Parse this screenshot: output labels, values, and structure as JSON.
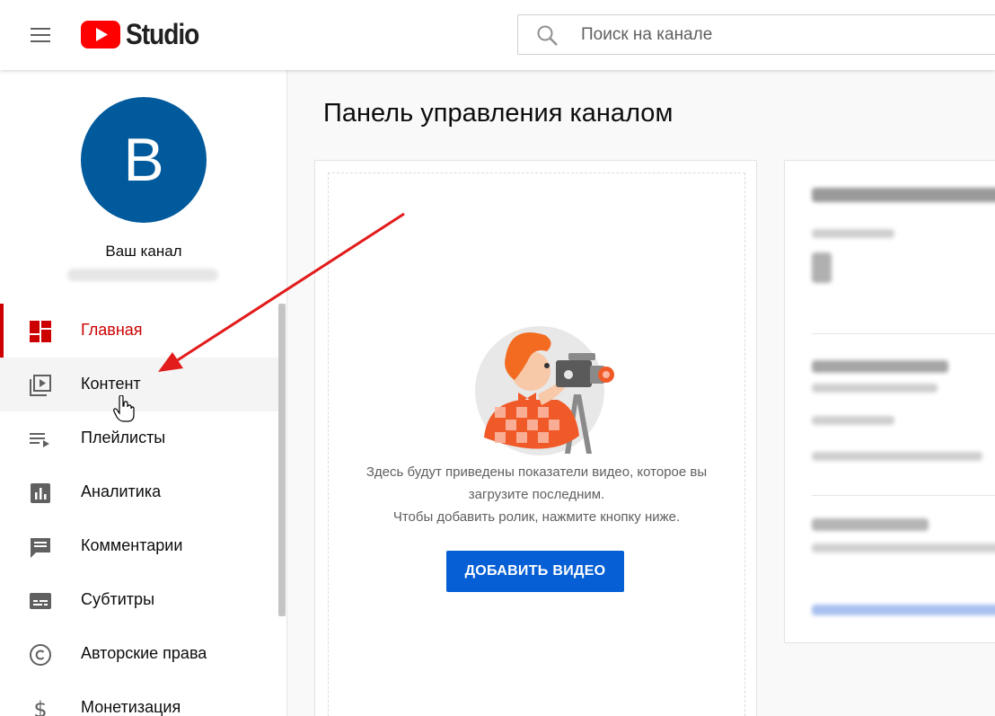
{
  "header": {
    "logo_text": "Studio",
    "search_placeholder": "Поиск на канале"
  },
  "sidebar": {
    "avatar_letter": "B",
    "channel_name": "Ваш канал",
    "items": [
      {
        "label": "Главная",
        "icon": "dashboard-icon",
        "active": true
      },
      {
        "label": "Контент",
        "icon": "content-icon"
      },
      {
        "label": "Плейлисты",
        "icon": "playlists-icon"
      },
      {
        "label": "Аналитика",
        "icon": "analytics-icon"
      },
      {
        "label": "Комментарии",
        "icon": "comments-icon"
      },
      {
        "label": "Субтитры",
        "icon": "subtitles-icon"
      },
      {
        "label": "Авторские права",
        "icon": "copyright-icon"
      },
      {
        "label": "Монетизация",
        "icon": "monetization-icon"
      }
    ]
  },
  "main": {
    "title": "Панель управления каналом",
    "upload_card": {
      "line1": "Здесь будут приведены показатели видео, которое вы",
      "line2": "загрузите последним.",
      "line3": "Чтобы добавить ролик, нажмите кнопку ниже.",
      "button_label": "ДОБАВИТЬ ВИДЕО"
    }
  },
  "colors": {
    "accent_red": "#cc0000",
    "button_blue": "#065fd4",
    "avatar_bg": "#005a9c"
  }
}
